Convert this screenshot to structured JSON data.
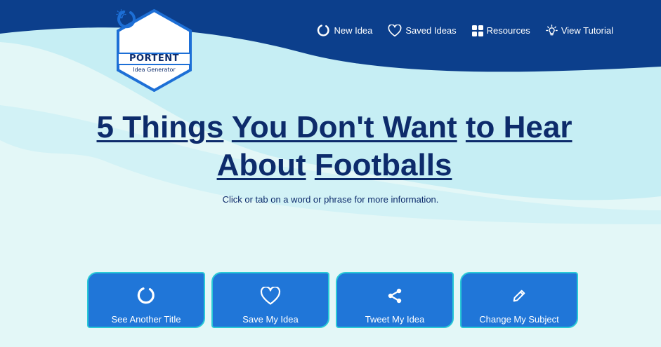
{
  "brand": {
    "name": "PORTENT",
    "tagline": "Idea Generator",
    "colors": {
      "navy": "#0c3f8c",
      "accent_blue": "#1d6fd6",
      "button_blue": "#2076d8",
      "button_border": "#29c9d6",
      "text_navy": "#0d2b6b"
    }
  },
  "nav": [
    {
      "label": "New Idea",
      "icon": "refresh-ring-icon"
    },
    {
      "label": "Saved Ideas",
      "icon": "heart-icon"
    },
    {
      "label": "Resources",
      "icon": "grid-icon"
    },
    {
      "label": "View Tutorial",
      "icon": "lightbulb-icon"
    }
  ],
  "headline": {
    "words": [
      "5 Things",
      "You Don't Want",
      "to Hear About",
      "Footballs"
    ]
  },
  "instruction": "Click or tab on a word or phrase for more information.",
  "actions": [
    {
      "label": "See Another Title",
      "icon": "refresh-ring-icon"
    },
    {
      "label": "Save My Idea",
      "icon": "heart-icon"
    },
    {
      "label": "Tweet My Idea",
      "icon": "share-icon"
    },
    {
      "label": "Change My Subject",
      "icon": "pencil-icon"
    }
  ]
}
